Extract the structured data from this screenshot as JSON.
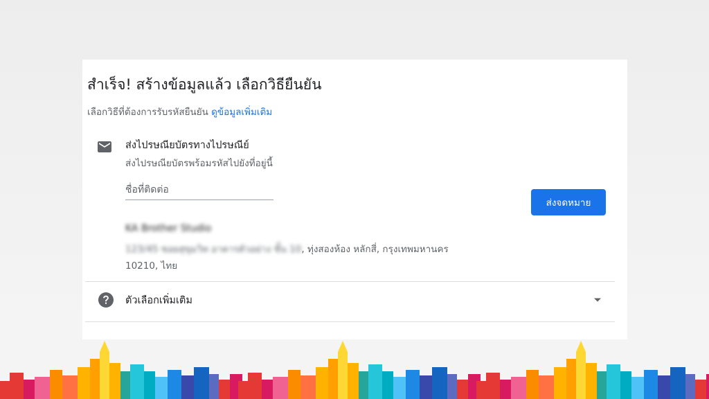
{
  "page": {
    "title": "สำเร็จ! สร้างข้อมูลแล้ว เลือกวิธียืนยัน",
    "subtitle": "เลือกวิธีที่ต้องการรับรหัสยืนยัน",
    "learn_more_link": "ดูข้อมูลเพิ่มเติม"
  },
  "postcard_option": {
    "icon": "mail-icon",
    "title": "ส่งไปรษณียบัตรทางไปรษณีย์",
    "description": "ส่งไปรษณียบัตรพร้อมรหัสไปยังที่อยู่นี้",
    "contact_placeholder": "ชื่อที่ติดต่อ",
    "contact_value": "",
    "send_button": "ส่งจดหมาย",
    "business_name": "KA Brother Studio",
    "address_blurred": "123/45 ซอยสุขุมวิท อาคารตัวอย่าง ชั้น 10",
    "address_visible": ", ทุ่งสองห้อง หลักสี่, กรุงเทพมหานคร",
    "address_line2": "10210, ไทย"
  },
  "more_options": {
    "icon": "help-icon",
    "label": "ตัวเลือกเพิ่มเติม",
    "expand_icon": "chevron-down-icon"
  },
  "colors": {
    "primary": "#1a73e8",
    "text_primary": "#202124",
    "text_secondary": "#5f6368",
    "divider": "#dadce0"
  },
  "decorations": {
    "footer": "city-skyline-illustration"
  }
}
